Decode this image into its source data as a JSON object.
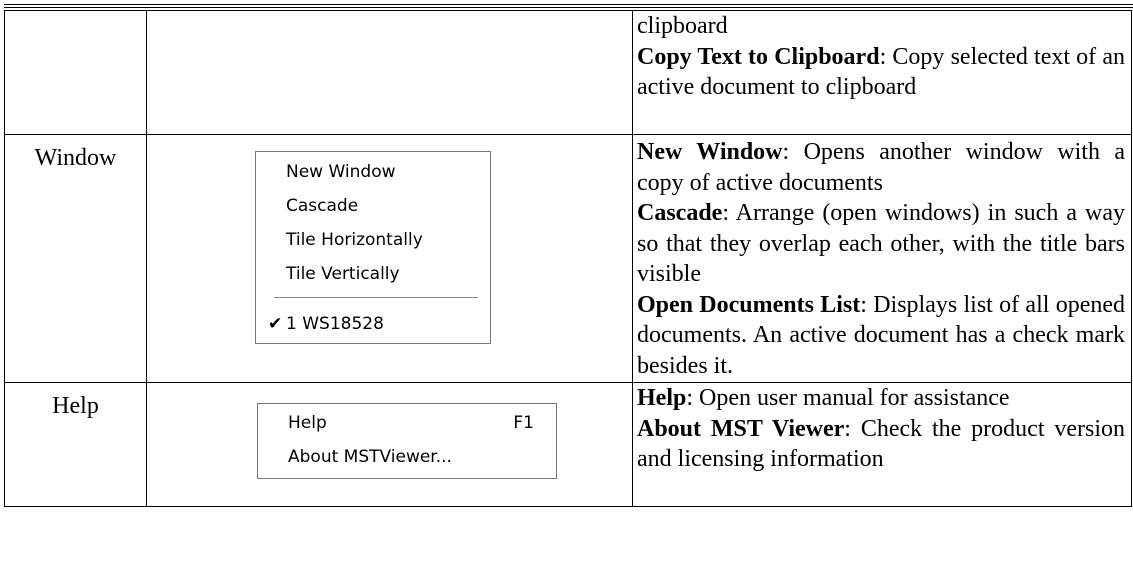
{
  "row_clipboard": {
    "desc_lines": [
      {
        "bold": "",
        "text": "clipboard"
      },
      {
        "bold": "Copy Text to Clipboard",
        "text": ": Copy selected text of an active document to clipboard"
      }
    ]
  },
  "row_window": {
    "name": "Window",
    "menu": {
      "items": [
        "New Window",
        "Cascade",
        "Tile Horizontally",
        "Tile Vertically"
      ],
      "checked_item_mark": "✔",
      "checked_item": "1 WS18528"
    },
    "desc": [
      {
        "bold": "New Window",
        "text": ": Opens another window with a copy of active documents"
      },
      {
        "bold": "Cascade",
        "text": ": Arrange (open windows) in such a way so that they overlap each other, with the title bars visible"
      },
      {
        "bold": "Open Documents List",
        "text": ": Displays list of all opened documents. An active document has a check mark besides it."
      }
    ]
  },
  "row_help": {
    "name": "Help",
    "menu": {
      "items": [
        {
          "label": "Help",
          "shortcut": "F1"
        },
        {
          "label": "About MSTViewer...",
          "shortcut": ""
        }
      ]
    },
    "desc": [
      {
        "bold": "Help",
        "text": ": Open user manual for assistance"
      },
      {
        "bold": "About MST Viewer",
        "text": ": Check the product version and licensing information"
      }
    ]
  }
}
